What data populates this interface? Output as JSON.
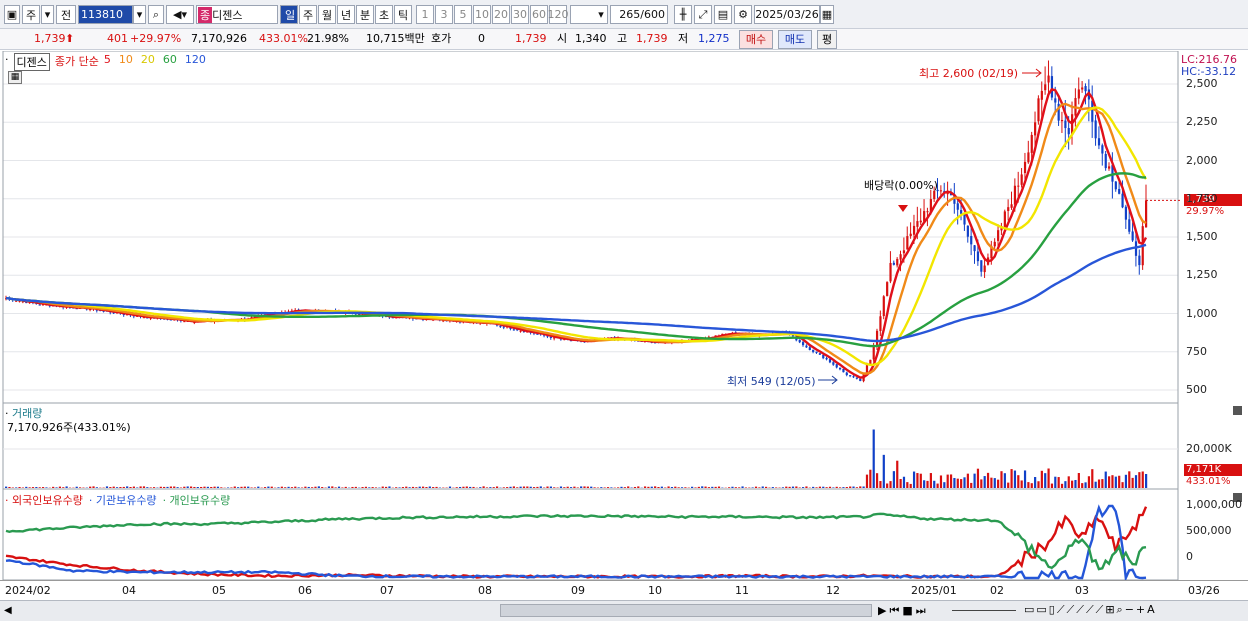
{
  "toolbar": {
    "market": "주",
    "prev": "전",
    "code": "113810",
    "name": "디젠스",
    "tabs": [
      "일",
      "주",
      "월",
      "년",
      "분",
      "초",
      "틱"
    ],
    "periods": [
      "1",
      "3",
      "5",
      "10",
      "20",
      "30",
      "60",
      "120"
    ],
    "count": "265",
    "count_max": "/600",
    "date": "2025/03/26",
    "name_prefix": "종"
  },
  "quote": {
    "price": "1,739",
    "arrow": "⬆",
    "change": "401",
    "change_pct": "+29.97%",
    "volume": "7,170,926",
    "vol_ratio": "433.01%",
    "turnover": "21.98%",
    "amount": "10,715백만",
    "hoga_label": "호가",
    "hoga": "0",
    "ask": "1,739",
    "open_label": "시",
    "open": "1,340",
    "high_label": "고",
    "high": "1,739",
    "low_label": "저",
    "low": "1,275",
    "buy": "매수",
    "sell": "매도",
    "eval": "평"
  },
  "price_panel": {
    "name": "디젠스",
    "legend_title": "종가 단순",
    "ma": [
      {
        "label": "5",
        "color": "#e0101a"
      },
      {
        "label": "10",
        "color": "#f08a18"
      },
      {
        "label": "20",
        "color": "#f2e600"
      },
      {
        "label": "60",
        "color": "#28a040"
      },
      {
        "label": "120",
        "color": "#2856d8"
      }
    ],
    "lc": "LC:216.76",
    "hc": "HC:-33.12",
    "max_annot": "최고 2,600 (02/19)",
    "min_annot": "최저 549 (12/05)",
    "div_annot": "배당락(0.00%)",
    "cur_tag": "1,739",
    "cur_pct": "29.97%"
  },
  "volume_panel": {
    "title": "거래량",
    "value": "7,170,926주(433.01%)",
    "tag": "7,171K",
    "tag_pct": "433.01%"
  },
  "holding_panel": {
    "legend": [
      {
        "label": "외국인보유수량",
        "color": "#d81010"
      },
      {
        "label": "기관보유수량",
        "color": "#2456d8"
      },
      {
        "label": "개인보유수량",
        "color": "#2a9a50"
      }
    ]
  },
  "chart_data": [
    {
      "type": "candlestick",
      "title": "디젠스",
      "ylim": [
        470,
        2630
      ],
      "yticks": [
        "2,500",
        "2,250",
        "2,000",
        "1,750",
        "1,500",
        "1,250",
        "1,000",
        "750",
        "500"
      ],
      "ytick_values": [
        2500,
        2250,
        2000,
        1750,
        1500,
        1250,
        1000,
        750,
        500
      ],
      "xticks": [
        "2024/02",
        "04",
        "05",
        "06",
        "07",
        "08",
        "09",
        "10",
        "11",
        "12",
        "2025/01",
        "02",
        "03",
        "03/26"
      ],
      "close_anchors": [
        [
          0,
          1100
        ],
        [
          10,
          1060
        ],
        [
          25,
          1030
        ],
        [
          40,
          980
        ],
        [
          55,
          950
        ],
        [
          70,
          960
        ],
        [
          85,
          1020
        ],
        [
          100,
          1010
        ],
        [
          115,
          980
        ],
        [
          130,
          960
        ],
        [
          145,
          930
        ],
        [
          155,
          880
        ],
        [
          165,
          830
        ],
        [
          172,
          815
        ],
        [
          180,
          840
        ],
        [
          188,
          820
        ],
        [
          195,
          810
        ],
        [
          205,
          830
        ],
        [
          215,
          870
        ],
        [
          225,
          860
        ],
        [
          232,
          880
        ],
        [
          238,
          780
        ],
        [
          244,
          700
        ],
        [
          250,
          600
        ],
        [
          254,
          560
        ],
        [
          257,
          700
        ],
        [
          260,
          1000
        ],
        [
          263,
          1300
        ],
        [
          266,
          1400
        ],
        [
          270,
          1550
        ],
        [
          274,
          1700
        ],
        [
          278,
          1820
        ],
        [
          282,
          1750
        ],
        [
          286,
          1500
        ],
        [
          290,
          1300
        ],
        [
          294,
          1450
        ],
        [
          298,
          1700
        ],
        [
          301,
          1850
        ],
        [
          304,
          2100
        ],
        [
          307,
          2350
        ],
        [
          310,
          2550
        ],
        [
          313,
          2300
        ],
        [
          316,
          2200
        ],
        [
          319,
          2500
        ],
        [
          322,
          2400
        ],
        [
          325,
          2100
        ],
        [
          328,
          1950
        ],
        [
          331,
          1800
        ],
        [
          334,
          1500
        ],
        [
          337,
          1350
        ],
        [
          339,
          1739
        ]
      ],
      "series": [
        {
          "name": "5",
          "period": 5
        },
        {
          "name": "10",
          "period": 10
        },
        {
          "name": "20",
          "period": 20
        },
        {
          "name": "60",
          "period": 60
        },
        {
          "name": "120",
          "period": 120
        }
      ],
      "max": {
        "label": "최고 2,600 (02/19)",
        "value": 2600
      },
      "min": {
        "label": "최저 549 (12/05)",
        "value": 549
      },
      "last": 1739
    },
    {
      "type": "bar",
      "title": "거래량",
      "ytick": "20,000K",
      "ytick_value": 20000,
      "ylim": [
        0,
        30000
      ],
      "last": 7171
    },
    {
      "type": "line",
      "title": "보유수량",
      "yticks": [
        "1,000,000",
        "500,000",
        "0"
      ],
      "ytick_values": [
        1000000,
        500000,
        0
      ],
      "series": [
        {
          "name": "외국인보유수량",
          "anchors": [
            [
              0,
              30
            ],
            [
              20,
              18
            ],
            [
              40,
              10
            ],
            [
              60,
              5
            ],
            [
              80,
              3
            ],
            [
              100,
              4
            ],
            [
              120,
              3
            ],
            [
              140,
              2
            ],
            [
              160,
              2
            ],
            [
              180,
              2
            ],
            [
              200,
              2
            ],
            [
              220,
              3
            ],
            [
              240,
              2
            ],
            [
              255,
              3
            ],
            [
              275,
              2
            ],
            [
              295,
              2
            ],
            [
              310,
              50
            ],
            [
              315,
              80
            ],
            [
              320,
              55
            ],
            [
              325,
              85
            ],
            [
              330,
              40
            ],
            [
              335,
              70
            ],
            [
              339,
              90
            ]
          ]
        },
        {
          "name": "기관보유수량",
          "anchors": [
            [
              0,
              25
            ],
            [
              20,
              10
            ],
            [
              40,
              8
            ],
            [
              60,
              8
            ],
            [
              80,
              8
            ],
            [
              100,
              3
            ],
            [
              120,
              2
            ],
            [
              140,
              2
            ],
            [
              160,
              2
            ],
            [
              180,
              2
            ],
            [
              200,
              2
            ],
            [
              220,
              2
            ],
            [
              240,
              2
            ],
            [
              255,
              2
            ],
            [
              275,
              2
            ],
            [
              295,
              2
            ],
            [
              310,
              3
            ],
            [
              320,
              2
            ],
            [
              325,
              95
            ],
            [
              330,
              95
            ],
            [
              333,
              3
            ],
            [
              339,
              3
            ]
          ]
        },
        {
          "name": "개인보유수량",
          "anchors": [
            [
              0,
              65
            ],
            [
              20,
              70
            ],
            [
              40,
              75
            ],
            [
              60,
              75
            ],
            [
              80,
              78
            ],
            [
              100,
              82
            ],
            [
              120,
              84
            ],
            [
              140,
              85
            ],
            [
              160,
              86
            ],
            [
              180,
              86
            ],
            [
              200,
              85
            ],
            [
              220,
              85
            ],
            [
              240,
              84
            ],
            [
              255,
              85
            ],
            [
              260,
              88
            ],
            [
              275,
              82
            ],
            [
              295,
              80
            ],
            [
              305,
              40
            ],
            [
              310,
              15
            ],
            [
              315,
              30
            ],
            [
              320,
              60
            ],
            [
              325,
              5
            ],
            [
              330,
              40
            ],
            [
              335,
              20
            ],
            [
              339,
              50
            ]
          ]
        }
      ]
    }
  ]
}
